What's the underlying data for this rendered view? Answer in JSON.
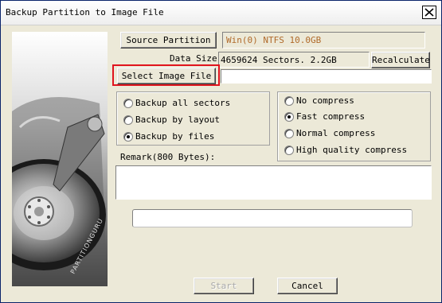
{
  "window": {
    "title": "Backup Partition to Image File"
  },
  "logo_text": "PARTITIONGURU",
  "source": {
    "button_label": "Source Partition",
    "value": "Win(0) NTFS 10.0GB"
  },
  "data_size": {
    "label": "Data Size:",
    "value": "4659624 Sectors. 2.2GB",
    "recalc_label": "Recalculate"
  },
  "image_file": {
    "button_label": "Select Image File",
    "path": ""
  },
  "backup_mode": {
    "options": [
      {
        "label": "Backup all sectors",
        "selected": false
      },
      {
        "label": "Backup by layout",
        "selected": false
      },
      {
        "label": "Backup by files",
        "selected": true
      }
    ]
  },
  "compression": {
    "options": [
      {
        "label": "No compress",
        "selected": false
      },
      {
        "label": "Fast compress",
        "selected": true
      },
      {
        "label": "Normal compress",
        "selected": false
      },
      {
        "label": "High quality compress",
        "selected": false
      }
    ]
  },
  "remark": {
    "label": "Remark(800 Bytes):",
    "value": ""
  },
  "progress": {
    "value": 0
  },
  "buttons": {
    "start": "Start",
    "cancel": "Cancel"
  },
  "colors": {
    "source_value": "#b06a2a",
    "highlight": "#e0141e"
  }
}
